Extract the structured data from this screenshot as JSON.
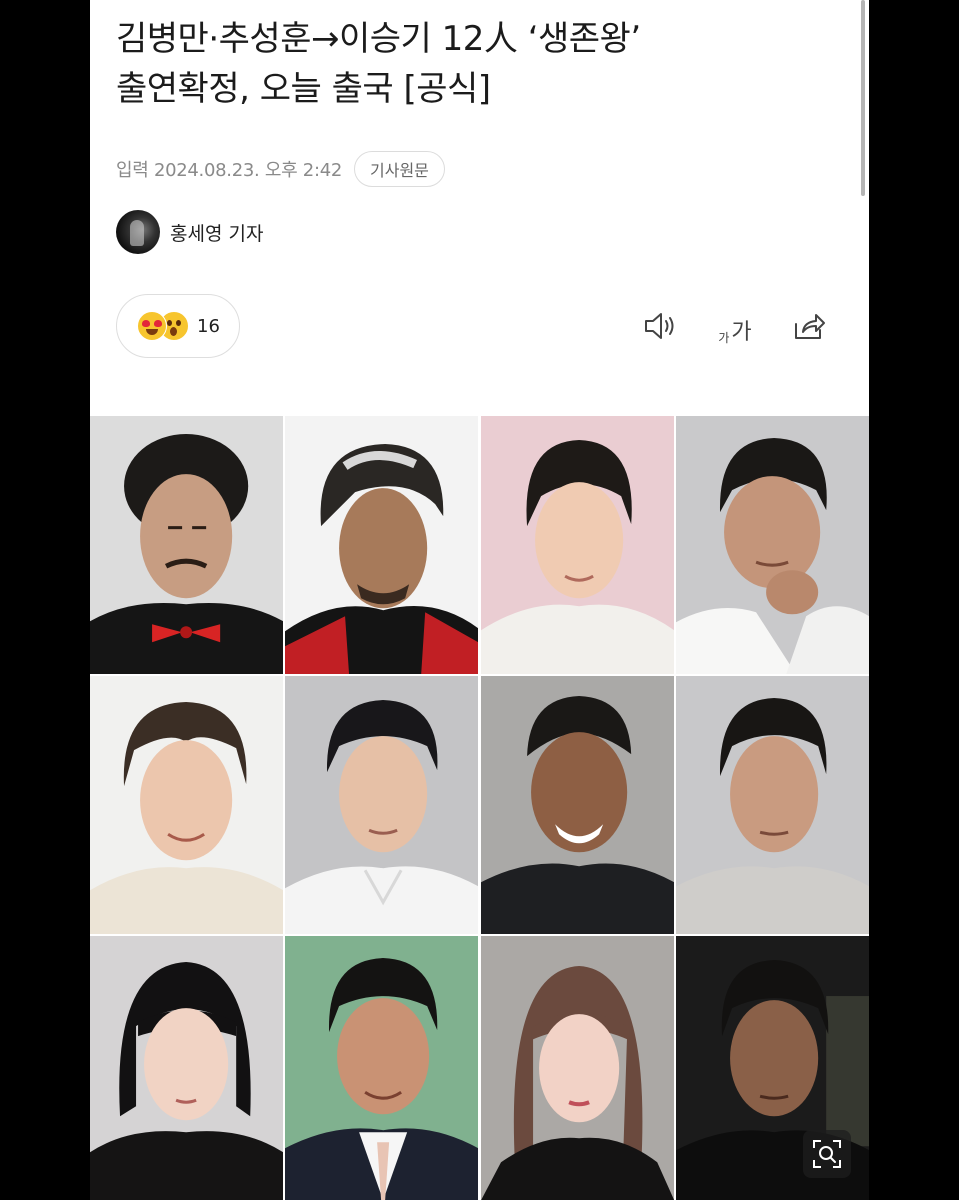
{
  "article": {
    "headline_line1": "김병만·추성훈→이승기 12人 ‘생존왕’",
    "headline_line2": "출연확정, 오늘 출국 [공식]",
    "timestamp": "입력 2024.08.23. 오후 2:42",
    "original_button": "기사원문",
    "reporter": "홍세영 기자"
  },
  "reactions": {
    "count": "16",
    "icons": [
      "heart-eyes-emoji",
      "surprised-emoji"
    ]
  },
  "toolbar": {
    "font_small": "가",
    "font_big": "가",
    "icons": [
      "speaker-icon",
      "font-size-icon",
      "share-icon"
    ]
  },
  "photo": {
    "rows": 3,
    "columns": 4,
    "backgrounds": [
      "#d9d9d9",
      "#f2f2f2",
      "#e9cbd0",
      "#c9c9cb",
      "#f1f1ef",
      "#c4c4c6",
      "#a9a8a6",
      "#c8c8ca",
      "#d4d2d3",
      "#7fb08e",
      "#a9a6a3",
      "#1a1a1a"
    ],
    "zoom_icon": "zoom-icon"
  },
  "colors": {
    "page_background": "#000000",
    "content_background": "#ffffff",
    "text_primary": "#1b1b1b",
    "text_meta": "#8a8a8a"
  }
}
